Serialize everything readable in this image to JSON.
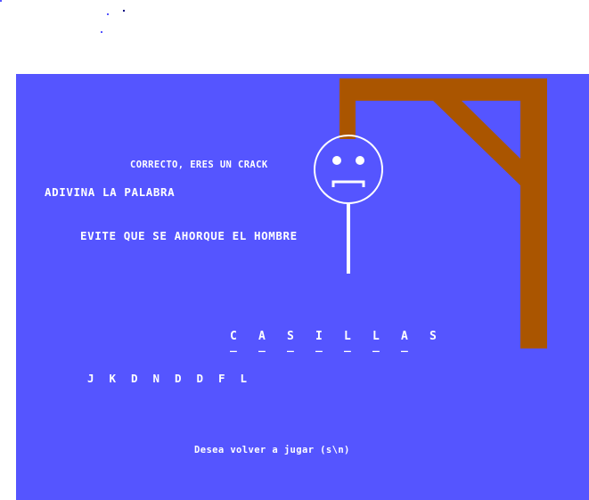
{
  "messages": {
    "feedback": "CORRECTO, ERES UN CRACK",
    "title": "ADIVINA LA PALABRA",
    "instruction": "EVITE QUE SE AHORQUE EL HOMBRE",
    "replay_prompt": "Desea volver a jugar (s\\n)"
  },
  "word": {
    "letters": [
      "C",
      "A",
      "S",
      "I",
      "L",
      "L",
      "A",
      "S"
    ],
    "underline": [
      "_",
      "_",
      "_",
      "_",
      "_",
      "_",
      "_",
      "_"
    ]
  },
  "wrong_letters": [
    "J",
    "K",
    "D",
    "N",
    "D",
    "D",
    "F",
    "L"
  ],
  "colors": {
    "background": "#5555ff",
    "text": "#ffffff",
    "gallows": "#aa5500",
    "figure": "#ffffff",
    "outer": "#ffffff"
  },
  "figure": {
    "parts_shown": [
      "head",
      "sad-face",
      "body"
    ],
    "expression": "sad"
  }
}
